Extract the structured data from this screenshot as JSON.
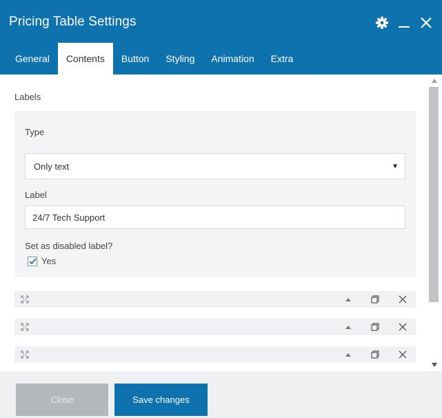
{
  "dialog": {
    "title": "Pricing Table Settings",
    "header_icons": [
      "gear-icon",
      "minimize-icon",
      "close-icon"
    ],
    "accent_color": "#0e72ae"
  },
  "tabs": [
    {
      "label": "General",
      "active": false
    },
    {
      "label": "Contents",
      "active": true
    },
    {
      "label": "Button",
      "active": false
    },
    {
      "label": "Styling",
      "active": false
    },
    {
      "label": "Animation",
      "active": false
    },
    {
      "label": "Extra",
      "active": false
    }
  ],
  "content": {
    "section_label": "Labels",
    "expanded_item": {
      "type_label": "Type",
      "type_value": "Only text",
      "label_label": "Label",
      "label_value": "24/7 Tech Support",
      "disabled_question": "Set as disabled label?",
      "checkbox_label": "Yes",
      "checkbox_checked": true
    },
    "item_actions": [
      "move-up",
      "duplicate",
      "remove"
    ],
    "collapsed_item_count": 3
  },
  "footer": {
    "close_label": "Close",
    "save_label": "Save changes"
  }
}
